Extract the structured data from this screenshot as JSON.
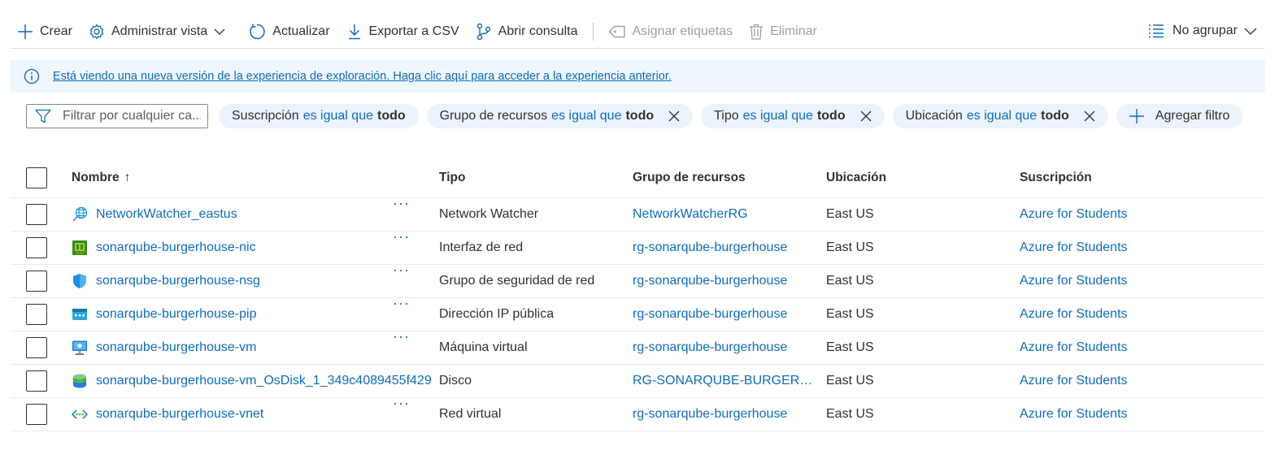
{
  "toolbar": {
    "create": "Crear",
    "manage_view": "Administrar vista",
    "refresh": "Actualizar",
    "export_csv": "Exportar a CSV",
    "open_query": "Abrir consulta",
    "assign_tags": "Asignar etiquetas",
    "delete": "Eliminar",
    "group_by": "No agrupar"
  },
  "banner": {
    "text": "Está viendo una nueva versión de la experiencia de exploración. Haga clic aquí para acceder a la experiencia anterior."
  },
  "filters": {
    "search_placeholder": "Filtrar por cualquier ca...",
    "pills": [
      {
        "field": "Suscripción",
        "op": "es igual que",
        "value": "todo"
      },
      {
        "field": "Grupo de recursos",
        "op": "es igual que",
        "value": "todo"
      },
      {
        "field": "Tipo",
        "op": "es igual que",
        "value": "todo"
      },
      {
        "field": "Ubicación",
        "op": "es igual que",
        "value": "todo"
      }
    ],
    "add_filter": "Agregar filtro"
  },
  "table": {
    "headers": {
      "name": "Nombre",
      "name_sort": "↑",
      "type": "Tipo",
      "resource_group": "Grupo de recursos",
      "location": "Ubicación",
      "subscription": "Suscripción"
    },
    "rows": [
      {
        "name": "NetworkWatcher_eastus",
        "icon": "network-watcher-icon",
        "more": "···",
        "type": "Network Watcher",
        "rg": "NetworkWatcherRG",
        "location": "East US",
        "subscription": "Azure for Students"
      },
      {
        "name": "sonarqube-burgerhouse-nic",
        "icon": "network-interface-icon",
        "more": "···",
        "type": "Interfaz de red",
        "rg": "rg-sonarqube-burgerhouse",
        "location": "East US",
        "subscription": "Azure for Students"
      },
      {
        "name": "sonarqube-burgerhouse-nsg",
        "icon": "network-security-group-icon",
        "more": "···",
        "type": "Grupo de seguridad de red",
        "rg": "rg-sonarqube-burgerhouse",
        "location": "East US",
        "subscription": "Azure for Students"
      },
      {
        "name": "sonarqube-burgerhouse-pip",
        "icon": "public-ip-icon",
        "more": "···",
        "type": "Dirección IP pública",
        "rg": "rg-sonarqube-burgerhouse",
        "location": "East US",
        "subscription": "Azure for Students"
      },
      {
        "name": "sonarqube-burgerhouse-vm",
        "icon": "virtual-machine-icon",
        "more": "···",
        "type": "Máquina virtual",
        "rg": "rg-sonarqube-burgerhouse",
        "location": "East US",
        "subscription": "Azure for Students"
      },
      {
        "name": "sonarqube-burgerhouse-vm_OsDisk_1_349c4089455f429",
        "icon": "disk-icon",
        "more": "",
        "type": "Disco",
        "rg": "RG-SONARQUBE-BURGERH...",
        "location": "East US",
        "subscription": "Azure for Students"
      },
      {
        "name": "sonarqube-burgerhouse-vnet",
        "icon": "virtual-network-icon",
        "more": "···",
        "type": "Red virtual",
        "rg": "rg-sonarqube-burgerhouse",
        "location": "East US",
        "subscription": "Azure for Students"
      }
    ]
  }
}
